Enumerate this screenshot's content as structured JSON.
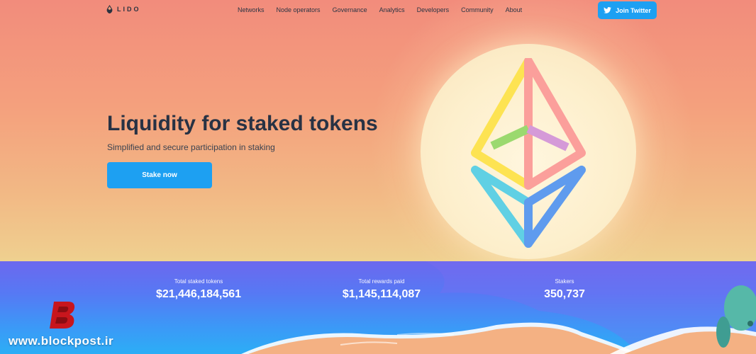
{
  "brand": {
    "logo_text": "LIDO",
    "logo_icon": "lido-drop-icon"
  },
  "nav": {
    "items": [
      {
        "label": "Networks"
      },
      {
        "label": "Node operators"
      },
      {
        "label": "Governance"
      },
      {
        "label": "Analytics"
      },
      {
        "label": "Developers"
      },
      {
        "label": "Community"
      },
      {
        "label": "About"
      }
    ],
    "twitter_label": "Join Twitter",
    "twitter_icon": "twitter-bird-icon"
  },
  "hero": {
    "title": "Liquidity for staked tokens",
    "subtitle": "Simplified and secure participation in staking",
    "cta_label": "Stake now",
    "illustration_icon": "ethereum-icon"
  },
  "stats": [
    {
      "label": "Total staked tokens",
      "value": "$21,446,184,561"
    },
    {
      "label": "Total rewards paid",
      "value": "$1,145,114,087"
    },
    {
      "label": "Stakers",
      "value": "350,737"
    }
  ],
  "watermark": {
    "text": "www.blockpost.ir",
    "logo_letter": "B"
  },
  "colors": {
    "accent": "#1da0f2",
    "heading": "#283244",
    "sea_top": "#6c68ee",
    "sea_bottom": "#2caef6",
    "sky_top": "#f28c7c",
    "sky_bottom": "#eed48f"
  }
}
